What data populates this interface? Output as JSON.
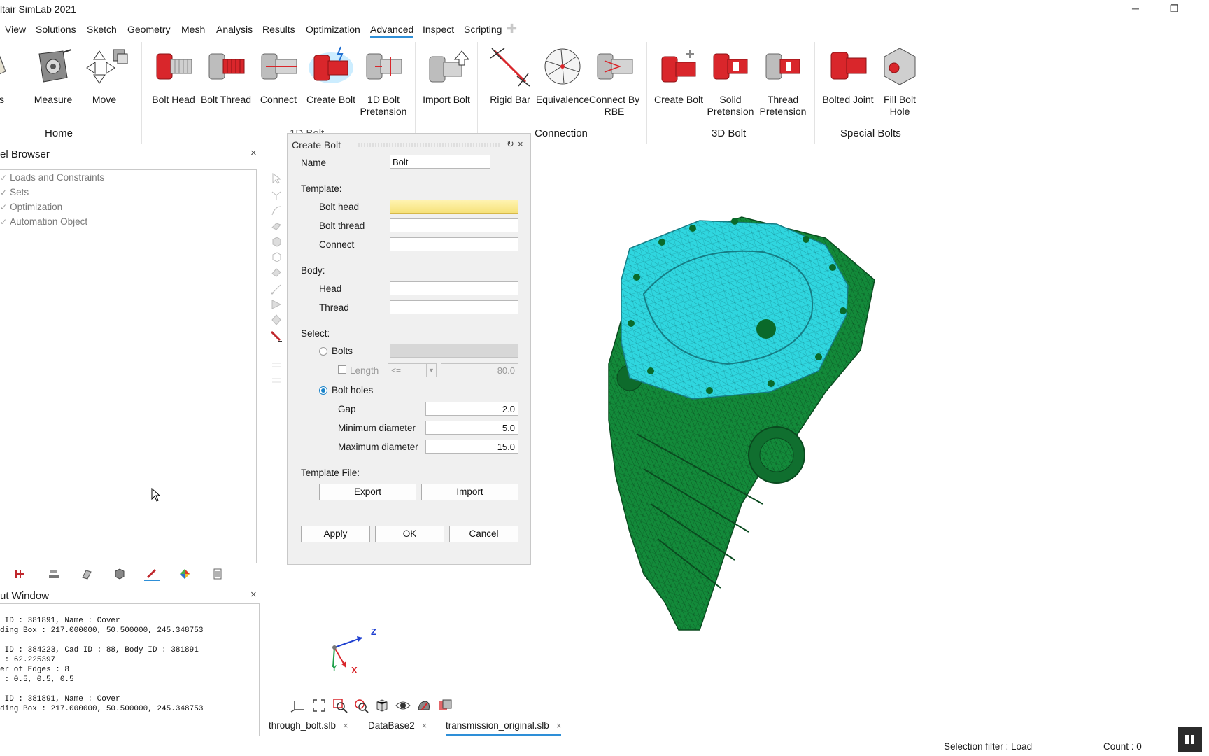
{
  "window": {
    "title": "ltair SimLab 2021",
    "minimize": "─",
    "restore": "❐"
  },
  "menu": {
    "items": [
      "View",
      "Solutions",
      "Sketch",
      "Geometry",
      "Mesh",
      "Analysis",
      "Results",
      "Optimization",
      "Advanced",
      "Inspect",
      "Scripting"
    ],
    "active": "Advanced",
    "add_tab": "✚"
  },
  "ribbon": {
    "home": {
      "partial_label": "es",
      "measure": "Measure",
      "move": "Move",
      "group": "Home"
    },
    "bolt1d": {
      "bolt_head": "Bolt Head",
      "bolt_thread": "Bolt Thread",
      "connect": "Connect",
      "create_bolt": "Create Bolt",
      "pretension_l1": "1D Bolt",
      "pretension_l2": "Pretension",
      "group": "1D Bolt"
    },
    "import": {
      "import_bolt": "Import Bolt"
    },
    "connection": {
      "rigid_bar": "Rigid Bar",
      "equivalence": "Equivalence",
      "rbe_l1": "Connect By",
      "rbe_l2": "RBE",
      "group": "Connection"
    },
    "bolt3d": {
      "create_bolt": "Create Bolt",
      "solid_l1": "Solid",
      "solid_l2": "Pretension",
      "thread_l1": "Thread",
      "thread_l2": "Pretension",
      "group": "3D Bolt"
    },
    "special": {
      "bolted_joint": "Bolted Joint",
      "fill_l1": "Fill Bolt",
      "fill_l2": "Hole",
      "group": "Special Bolts"
    }
  },
  "model_browser": {
    "title": "el Browser",
    "close": "×",
    "items": [
      "Loads and Constraints",
      "Sets",
      "Optimization",
      "Automation Object"
    ]
  },
  "output_window": {
    "title": "ut Window",
    "close": "×",
    "lines": [
      " ID : 381891, Name : Cover",
      "ding Box : 217.000000, 50.500000, 245.348753",
      "",
      " ID : 384223, Cad ID : 88, Body ID : 381891",
      " : 62.225397",
      "er of Edges : 8",
      " : 0.5, 0.5, 0.5",
      "",
      " ID : 381891, Name : Cover",
      "ding Box : 217.000000, 50.500000, 245.348753"
    ]
  },
  "dialog": {
    "title": "Create Bolt",
    "reset": "↻",
    "close": "×",
    "name_label": "Name",
    "name_value": "Bolt",
    "template_label": "Template:",
    "bolt_head_label": "Bolt head",
    "bolt_thread_label": "Bolt thread",
    "connect_label": "Connect",
    "body_label": "Body:",
    "head_label": "Head",
    "thread_label": "Thread",
    "select_label": "Select:",
    "bolts_label": "Bolts",
    "length_label": "Length",
    "length_op": "<=",
    "length_value": "80.0",
    "bolt_holes_label": "Bolt holes",
    "gap_label": "Gap",
    "gap_value": "2.0",
    "min_label": "Minimum diameter",
    "min_value": "5.0",
    "max_label": "Maximum diameter",
    "max_value": "15.0",
    "template_file_label": "Template File:",
    "export": "Export",
    "import": "Import",
    "apply": "Apply",
    "ok": "OK",
    "cancel": "Cancel"
  },
  "triad": {
    "z": "Z",
    "y": "Y",
    "x": "X"
  },
  "file_tabs": [
    {
      "name": "through_bolt.slb",
      "close": "×"
    },
    {
      "name": "DataBase2",
      "close": "×"
    },
    {
      "name": "transmission_original.slb",
      "close": "×"
    }
  ],
  "status": {
    "selection_filter": "Selection filter : Load",
    "count": "Count : 0"
  },
  "colors": {
    "mesh_cyan": "#2fd6df",
    "mesh_green": "#138a3a",
    "bolt_red": "#d9262b",
    "accent": "#2e8fd8"
  }
}
